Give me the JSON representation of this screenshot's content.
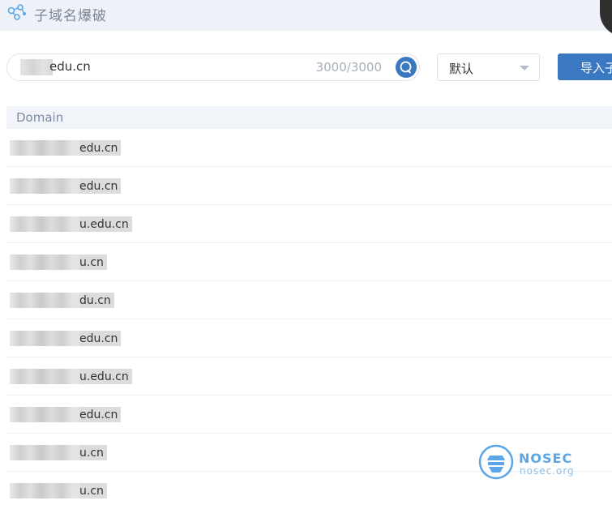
{
  "header": {
    "title": "子域名爆破"
  },
  "search": {
    "value": "edu.cn",
    "count": "3000/3000"
  },
  "filter": {
    "selected": "默认"
  },
  "import_button": {
    "label": "导入子"
  },
  "table": {
    "columns": [
      "Domain"
    ],
    "rows": [
      "edu.cn",
      "edu.cn",
      "u.edu.cn",
      "u.cn",
      "du.cn",
      "edu.cn",
      "u.edu.cn",
      "edu.cn",
      "u.cn",
      "u.cn"
    ]
  },
  "watermark": {
    "name": "NOSEC",
    "url": "nosec.org"
  },
  "colors": {
    "accent": "#3a78c2",
    "header_bg": "#eef2f8",
    "table_header_bg": "#f1f4f9"
  }
}
